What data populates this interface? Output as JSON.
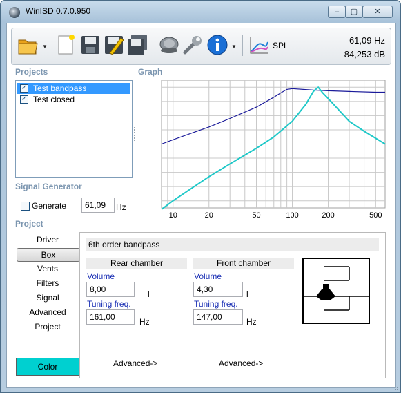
{
  "window": {
    "title": "WinISD 0.7.0.950"
  },
  "caption_buttons": {
    "minimize": "–",
    "maximize": "▢",
    "close": "✕"
  },
  "toolbar": {
    "spl_label": "SPL",
    "readout_frequency": "61,09 Hz",
    "readout_level": "84,253 dB"
  },
  "sections": {
    "projects": "Projects",
    "graph": "Graph",
    "signal_generator": "Signal Generator",
    "project": "Project"
  },
  "projects": [
    {
      "name": "Test bandpass",
      "checked": true,
      "selected": true
    },
    {
      "name": "Test closed",
      "checked": true,
      "selected": false
    }
  ],
  "signal_generator": {
    "generate_label": "Generate",
    "checked": false,
    "frequency": "61,09",
    "unit": "Hz"
  },
  "nav": {
    "items": [
      "Driver",
      "Box",
      "Vents",
      "Filters",
      "Signal",
      "Advanced",
      "Project"
    ],
    "active": "Box",
    "color_button": "Color"
  },
  "box_panel": {
    "header": "6th order bandpass",
    "rear": {
      "title": "Rear chamber",
      "volume_label": "Volume",
      "volume": "8,00",
      "volume_unit": "l",
      "tuning_label": "Tuning freq.",
      "tuning": "161,00",
      "tuning_unit": "Hz",
      "advanced": "Advanced->"
    },
    "front": {
      "title": "Front chamber",
      "volume_label": "Volume",
      "volume": "4,30",
      "volume_unit": "l",
      "tuning_label": "Tuning freq.",
      "tuning": "147,00",
      "tuning_unit": "Hz",
      "advanced": "Advanced->"
    }
  },
  "chart_data": {
    "type": "line",
    "xscale": "log",
    "xlim": [
      8,
      600
    ],
    "ylim": [
      5,
      95
    ],
    "x_ticks": [
      10,
      20,
      50,
      100,
      200,
      500
    ],
    "y_ticks": [
      10,
      20,
      30,
      40,
      50,
      60,
      70,
      80,
      90
    ],
    "grid": true,
    "series": [
      {
        "color": "#1a1a9a",
        "x": [
          8,
          10,
          20,
          30,
          50,
          70,
          80,
          90,
          100,
          150,
          200,
          300,
          500,
          600
        ],
        "y": [
          50,
          53,
          62,
          68,
          76,
          83,
          86,
          88.5,
          89,
          88,
          87.5,
          87,
          86.5,
          86.5
        ]
      },
      {
        "color": "#1ec8c8",
        "x": [
          8,
          10,
          15,
          20,
          30,
          50,
          70,
          100,
          130,
          150,
          165,
          180,
          200,
          300,
          400,
          600
        ],
        "y": [
          4,
          10,
          20,
          27,
          36,
          47,
          55,
          66,
          78,
          87,
          90,
          86,
          82,
          66,
          59,
          50
        ]
      }
    ]
  },
  "colors": {
    "accent_label": "#7c96b0",
    "field_label": "#1a2fb4",
    "color_swatch": "#00d0d0",
    "selection": "#3399ff"
  },
  "icons": {
    "open": "open-folder-icon",
    "new": "new-document-icon",
    "save": "save-icon",
    "edit": "edit-icon",
    "save_all": "save-all-icon",
    "speaker": "speaker-icon",
    "tools": "wrench-icon",
    "info": "info-icon",
    "chart": "spl-chart-icon"
  }
}
